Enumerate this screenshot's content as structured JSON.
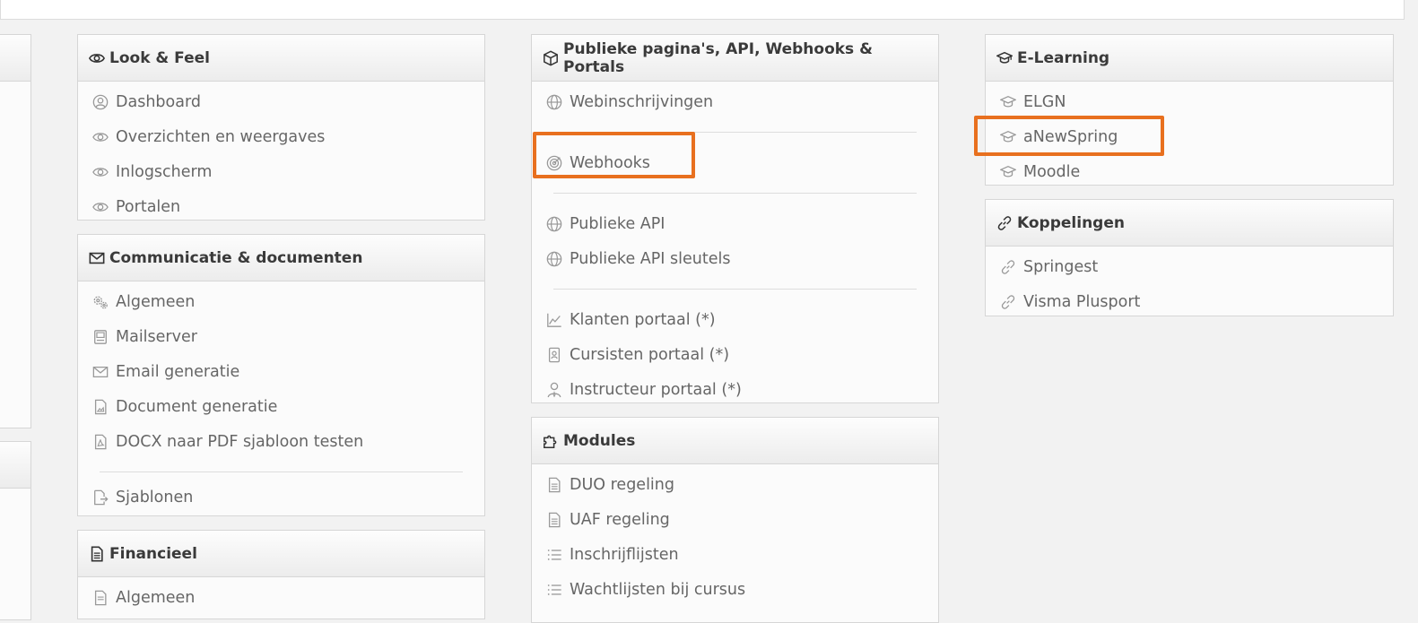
{
  "panels": {
    "look": {
      "title": "Look & Feel",
      "items": [
        "Dashboard",
        "Overzichten en weergaves",
        "Inlogscherm",
        "Portalen"
      ]
    },
    "comm": {
      "title": "Communicatie & documenten",
      "items": [
        "Algemeen",
        "Mailserver",
        "Email generatie",
        "Document generatie",
        "DOCX naar PDF sjabloon testen",
        "Sjablonen"
      ]
    },
    "fin": {
      "title": "Financieel",
      "items": [
        "Algemeen"
      ]
    },
    "pub": {
      "title": "Publieke pagina's, API, Webhooks & Portals",
      "items": [
        "Webinschrijvingen",
        "Webhooks",
        "Publieke API",
        "Publieke API sleutels",
        "Klanten portaal (*)",
        "Cursisten portaal (*)",
        "Instructeur portaal (*)"
      ]
    },
    "mod": {
      "title": "Modules",
      "items": [
        "DUO regeling",
        "UAF regeling",
        "Inschrijflijsten",
        "Wachtlijsten bij cursus"
      ]
    },
    "elearn": {
      "title": "E-Learning",
      "items": [
        "ELGN",
        "aNewSpring",
        "Moodle"
      ]
    },
    "kopp": {
      "title": "Koppelingen",
      "items": [
        "Springest",
        "Visma Plusport"
      ]
    }
  },
  "colors": {
    "highlight": "#e8701f"
  }
}
